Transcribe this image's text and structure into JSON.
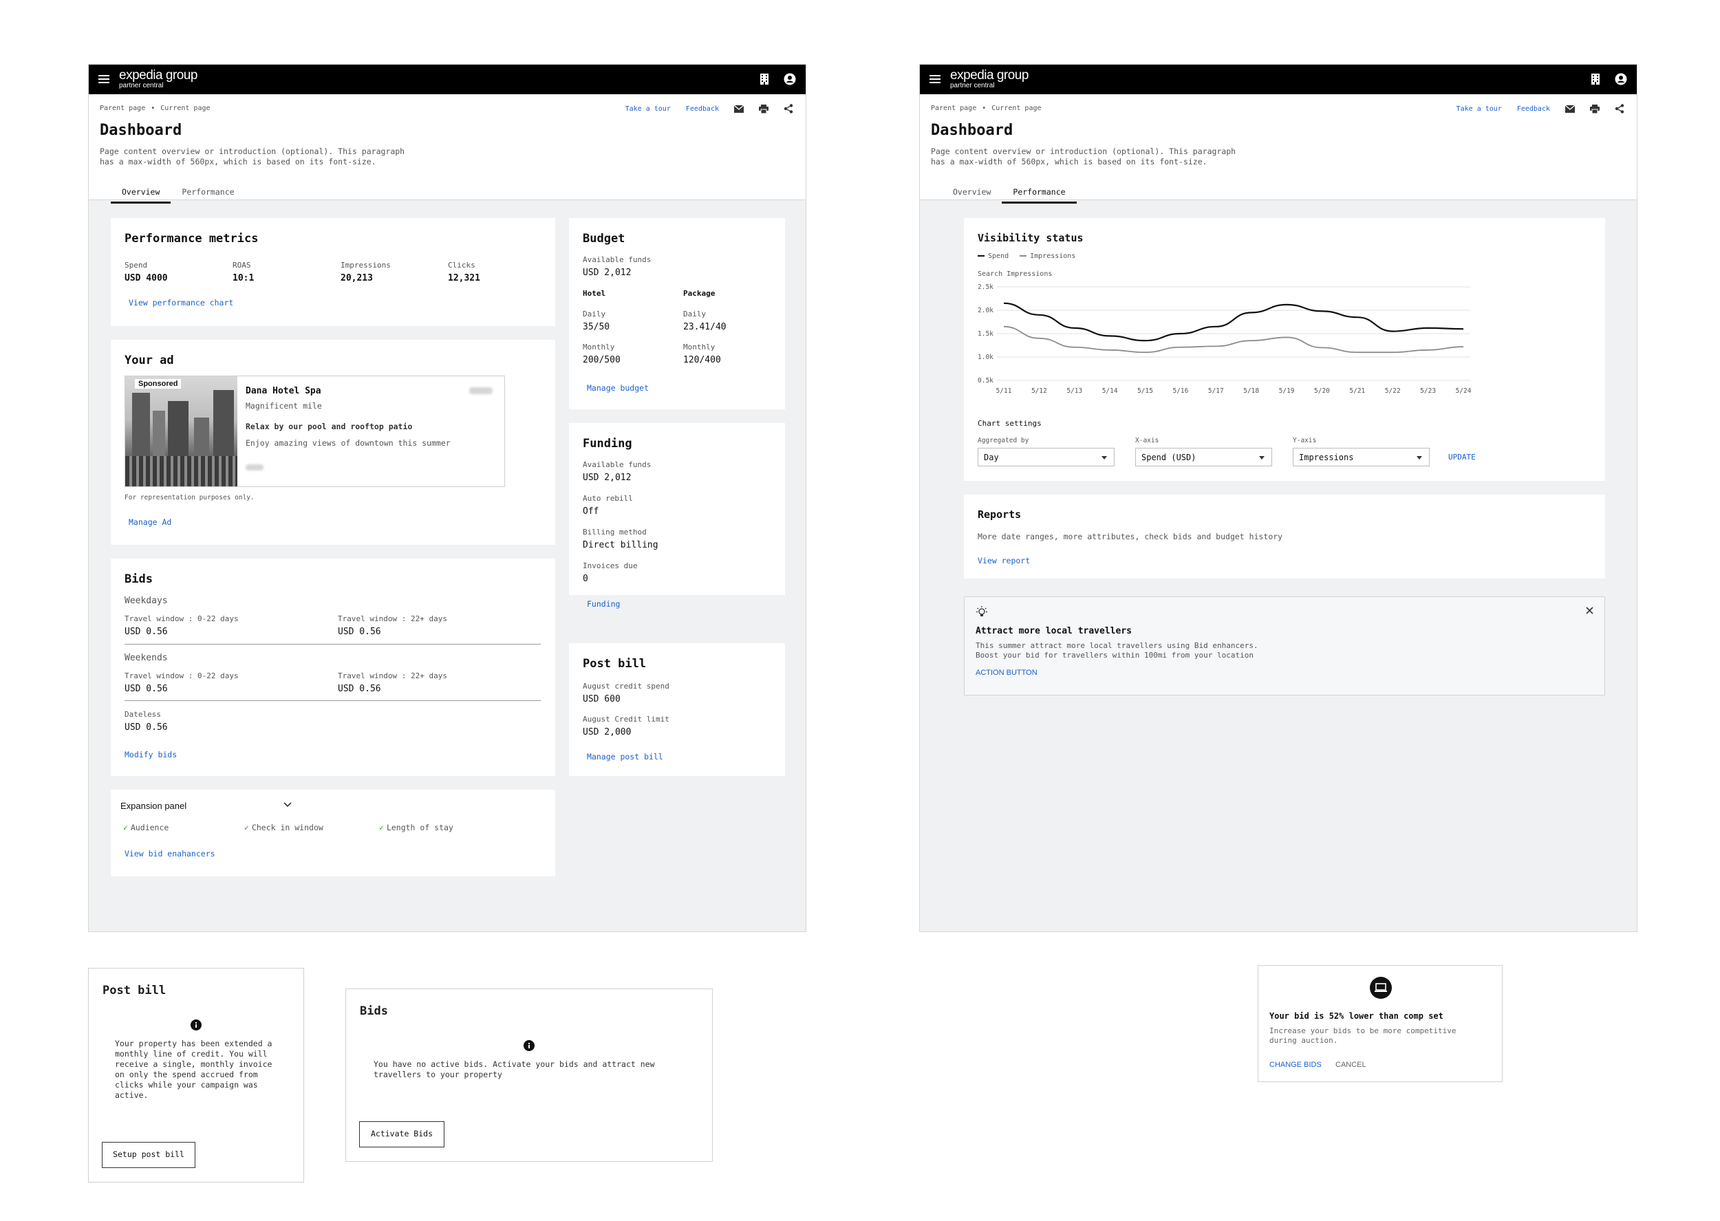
{
  "brand": {
    "name": "expedia group",
    "sub": "partner central"
  },
  "header": {
    "crumb_parent": "Parent page",
    "crumb_current": "Current page",
    "tour": "Take a tour",
    "feedback": "Feedback",
    "title": "Dashboard",
    "intro": "Page content overview or introduction (optional). This paragraph has a max-width of 560px, which is based on its font-size.",
    "tabs": [
      "Overview",
      "Performance"
    ]
  },
  "metrics": {
    "title": "Performance metrics",
    "items": [
      {
        "label": "Spend",
        "value": "USD 4000"
      },
      {
        "label": "ROAS",
        "value": "10:1"
      },
      {
        "label": "Impressions",
        "value": "20,213"
      },
      {
        "label": "Clicks",
        "value": "12,321"
      }
    ],
    "link": "View performance chart"
  },
  "ad": {
    "title": "Your ad",
    "sponsored": "Sponsored",
    "hotel": "Dana Hotel Spa",
    "location": "Magnificent mile",
    "headline": "Relax by our pool and rooftop patio",
    "desc": "Enjoy amazing views of downtown this summer",
    "note": "For representation purposes only.",
    "link": "Manage Ad"
  },
  "bids": {
    "title": "Bids",
    "weekdays": "Weekdays",
    "weekends": "Weekends",
    "tw1": "Travel window : 0-22 days",
    "tw2": "Travel window : 22+ days",
    "v1": "USD 0.56",
    "v2": "USD 0.56",
    "v3": "USD 0.56",
    "v4": "USD 0.56",
    "dateless": "Dateless",
    "v5": "USD 0.56",
    "link": "Modify bids"
  },
  "expansion": {
    "title": "Expansion panel",
    "checks": [
      "Audience",
      "Check in window",
      "Length of stay"
    ],
    "link": "View bid enahancers"
  },
  "budget": {
    "title": "Budget",
    "avail_label": "Available funds",
    "avail": "USD 2,012",
    "hotel": "Hotel",
    "package": "Package",
    "daily": "Daily",
    "monthly": "Monthly",
    "hotel_daily": "35/50",
    "hotel_monthly": "200/500",
    "pkg_daily": "23.41/40",
    "pkg_monthly": "120/400",
    "link": "Manage budget"
  },
  "funding": {
    "title": "Funding",
    "avail_label": "Available funds",
    "avail": "USD 2,012",
    "refill_label": "Auto rebill",
    "refill": "Off",
    "billing_label": "Billing method",
    "billing": "Direct billing",
    "invoices_label": "Invoices due",
    "invoices": "0",
    "link": "Funding"
  },
  "postbill": {
    "title": "Post bill",
    "spend_label": "August credit spend",
    "spend": "USD 600",
    "limit_label": "August Credit limit",
    "limit": "USD 2,000",
    "link": "Manage post bill"
  },
  "visibility": {
    "title": "Visibility status",
    "settings": "Chart settings",
    "agg_label": "Aggregated by",
    "agg": "Day",
    "x_label": "X-axis",
    "x": "Spend (USD)",
    "y_label": "Y-axis",
    "y": "Impressions",
    "update": "UPDATE"
  },
  "chart_data": {
    "type": "line",
    "ylabel": "Search Impressions",
    "x": [
      "5/11",
      "5/12",
      "5/13",
      "5/14",
      "5/15",
      "5/16",
      "5/17",
      "5/18",
      "5/19",
      "5/20",
      "5/21",
      "5/22",
      "5/23",
      "5/24"
    ],
    "ylim": [
      500,
      2500
    ],
    "yticks": [
      "0.5k",
      "1.0k",
      "1.5k",
      "2.0k",
      "2.5k"
    ],
    "series": [
      {
        "name": "Spend",
        "color": "#111111",
        "values": [
          2150,
          1900,
          1620,
          1450,
          1350,
          1500,
          1650,
          1950,
          2120,
          1980,
          1850,
          1550,
          1620,
          1600
        ]
      },
      {
        "name": "Impressions",
        "color": "#8c8c8c",
        "values": [
          1650,
          1400,
          1210,
          1150,
          1100,
          1210,
          1230,
          1350,
          1420,
          1200,
          1100,
          1100,
          1150,
          1220
        ]
      }
    ]
  },
  "reports": {
    "title": "Reports",
    "desc": "More date ranges, more attributes, check bids and budget history",
    "link": "View report"
  },
  "attract": {
    "title": "Attract more local travellers",
    "l1": "This summer attract more local travellers using Bid enhancers.",
    "l2": "Boost your bid for travellers within 100mi from your location",
    "action": "ACTION BUTTON"
  },
  "empty_postbill": {
    "title": "Post bill",
    "text": "Your property has been extended a monthly line of credit. You will receive a single, monthly invoice on only the spend accrued from clicks while your campaign was active.",
    "button": "Setup post bill"
  },
  "empty_bids": {
    "title": "Bids",
    "text": "You have no active bids. Activate your bids and attract new travellers to your property",
    "button": "Activate Bids"
  },
  "lowbid": {
    "title": "Your bid is 52% lower than comp set",
    "text": "Increase your bids to be more competitive during auction.",
    "change": "CHANGE BIDS",
    "cancel": "CANCEL"
  }
}
